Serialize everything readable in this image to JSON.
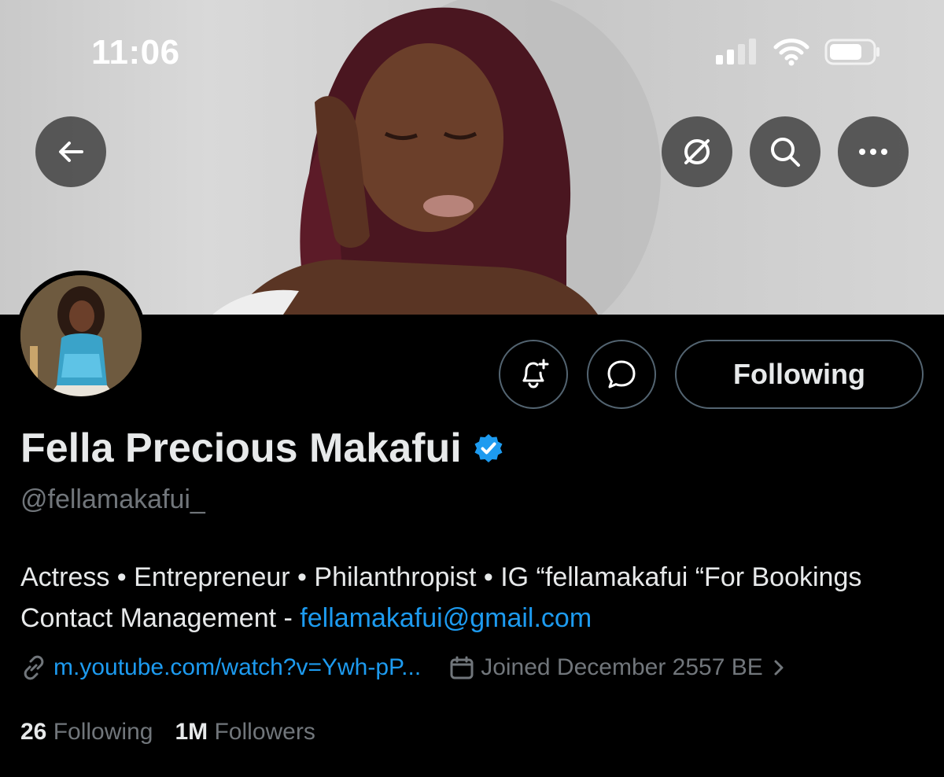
{
  "status_bar": {
    "time": "11:06"
  },
  "header": {
    "back_icon": "arrow-left-icon",
    "grok_icon": "slash-circle-icon",
    "search_icon": "search-icon",
    "more_icon": "more-horizontal-icon"
  },
  "profile": {
    "display_name": "Fella Precious Makafui",
    "verified": true,
    "handle": "@fellamakafui_",
    "bio_text": "Actress • Entrepreneur • Philanthropist • IG “fellamakafui “For Bookings Contact Management - ",
    "bio_email": "fellamakafui@gmail.com",
    "link_text": "m.youtube.com/watch?v=Ywh-pP...",
    "joined_text": "Joined December 2557 BE",
    "following_count": "26",
    "following_label": "Following",
    "followers_count": "1M",
    "followers_label": "Followers"
  },
  "actions": {
    "notify_icon": "bell-plus-icon",
    "message_icon": "message-bubble-icon",
    "following_button_label": "Following"
  },
  "colors": {
    "accent": "#1d9bf0",
    "background": "#000000",
    "muted": "#71767b"
  }
}
